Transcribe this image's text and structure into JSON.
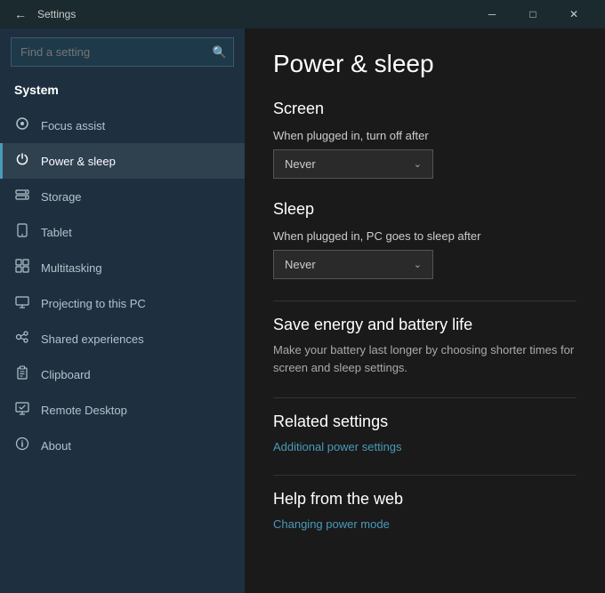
{
  "titlebar": {
    "title": "Settings",
    "minimize_label": "─",
    "maximize_label": "□",
    "close_label": "✕"
  },
  "sidebar": {
    "search_placeholder": "Find a setting",
    "search_icon": "🔍",
    "system_label": "System",
    "items": [
      {
        "id": "focus-assist",
        "label": "Focus assist",
        "icon": "🔔"
      },
      {
        "id": "power-sleep",
        "label": "Power & sleep",
        "icon": "⏻",
        "active": true
      },
      {
        "id": "storage",
        "label": "Storage",
        "icon": "🗄"
      },
      {
        "id": "tablet",
        "label": "Tablet",
        "icon": "⬜"
      },
      {
        "id": "multitasking",
        "label": "Multitasking",
        "icon": "⊞"
      },
      {
        "id": "projecting",
        "label": "Projecting to this PC",
        "icon": "📽"
      },
      {
        "id": "shared-experiences",
        "label": "Shared experiences",
        "icon": "✦"
      },
      {
        "id": "clipboard",
        "label": "Clipboard",
        "icon": "📋"
      },
      {
        "id": "remote-desktop",
        "label": "Remote Desktop",
        "icon": "🖥"
      },
      {
        "id": "about",
        "label": "About",
        "icon": "ℹ"
      }
    ]
  },
  "main": {
    "page_title": "Power & sleep",
    "screen_section": {
      "title": "Screen",
      "label": "When plugged in, turn off after",
      "dropdown_value": "Never"
    },
    "sleep_section": {
      "title": "Sleep",
      "label": "When plugged in, PC goes to sleep after",
      "dropdown_value": "Never"
    },
    "energy_section": {
      "title": "Save energy and battery life",
      "description": "Make your battery last longer by choosing shorter times for screen and sleep settings."
    },
    "related_section": {
      "title": "Related settings",
      "link": "Additional power settings"
    },
    "help_section": {
      "title": "Help from the web",
      "link": "Changing power mode"
    }
  }
}
